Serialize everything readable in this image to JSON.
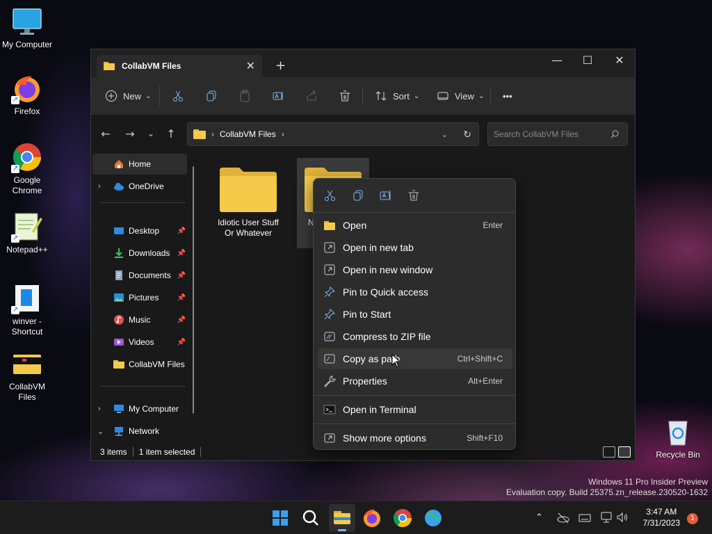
{
  "desktop": {
    "icons": [
      {
        "label": "My Computer"
      },
      {
        "label": "Firefox"
      },
      {
        "label": "Google Chrome"
      },
      {
        "label": "Notepad++"
      },
      {
        "label": "winver - Shortcut"
      },
      {
        "label": "CollabVM Files"
      },
      {
        "label": "Recycle Bin"
      }
    ]
  },
  "window": {
    "tab_title": "CollabVM Files",
    "toolbar": {
      "new_label": "New",
      "sort_label": "Sort",
      "view_label": "View",
      "more_label": "•••"
    },
    "address": {
      "path_segment": "CollabVM Files"
    },
    "search": {
      "placeholder": "Search CollabVM Files"
    },
    "sidebar": [
      {
        "label": "Home",
        "icon": "home-icon"
      },
      {
        "label": "OneDrive",
        "icon": "cloud-icon"
      },
      {
        "label": "Desktop",
        "icon": "desktop-icon"
      },
      {
        "label": "Downloads",
        "icon": "download-icon"
      },
      {
        "label": "Documents",
        "icon": "document-icon"
      },
      {
        "label": "Pictures",
        "icon": "picture-icon"
      },
      {
        "label": "Music",
        "icon": "music-icon"
      },
      {
        "label": "Videos",
        "icon": "video-icon"
      },
      {
        "label": "CollabVM Files",
        "icon": "folder-icon"
      },
      {
        "label": "My Computer",
        "icon": "computer-icon"
      },
      {
        "label": "Network",
        "icon": "network-icon"
      }
    ],
    "files": [
      {
        "name": "Idiotic User Stuff Or Whatever"
      },
      {
        "name": "N"
      }
    ],
    "status": {
      "count": "3 items",
      "selection": "1 item selected"
    }
  },
  "context_menu": {
    "items": [
      {
        "label": "Open",
        "shortcut": "Enter"
      },
      {
        "label": "Open in new tab",
        "shortcut": ""
      },
      {
        "label": "Open in new window",
        "shortcut": ""
      },
      {
        "label": "Pin to Quick access",
        "shortcut": ""
      },
      {
        "label": "Pin to Start",
        "shortcut": ""
      },
      {
        "label": "Compress to ZIP file",
        "shortcut": ""
      },
      {
        "label": "Copy as path",
        "shortcut": "Ctrl+Shift+C"
      },
      {
        "label": "Properties",
        "shortcut": "Alt+Enter"
      },
      {
        "label": "Open in Terminal",
        "shortcut": ""
      },
      {
        "label": "Show more options",
        "shortcut": "Shift+F10"
      }
    ]
  },
  "watermark": {
    "line1": "Windows 11 Pro Insider Preview",
    "line2": "Evaluation copy. Build 25375.zn_release.230520-1632"
  },
  "taskbar": {
    "time": "3:47 AM",
    "date": "7/31/2023",
    "notification_count": "1"
  },
  "colors": {
    "folder": "#f5c94a",
    "accent": "#7fb8f0",
    "bg": "#191919"
  }
}
